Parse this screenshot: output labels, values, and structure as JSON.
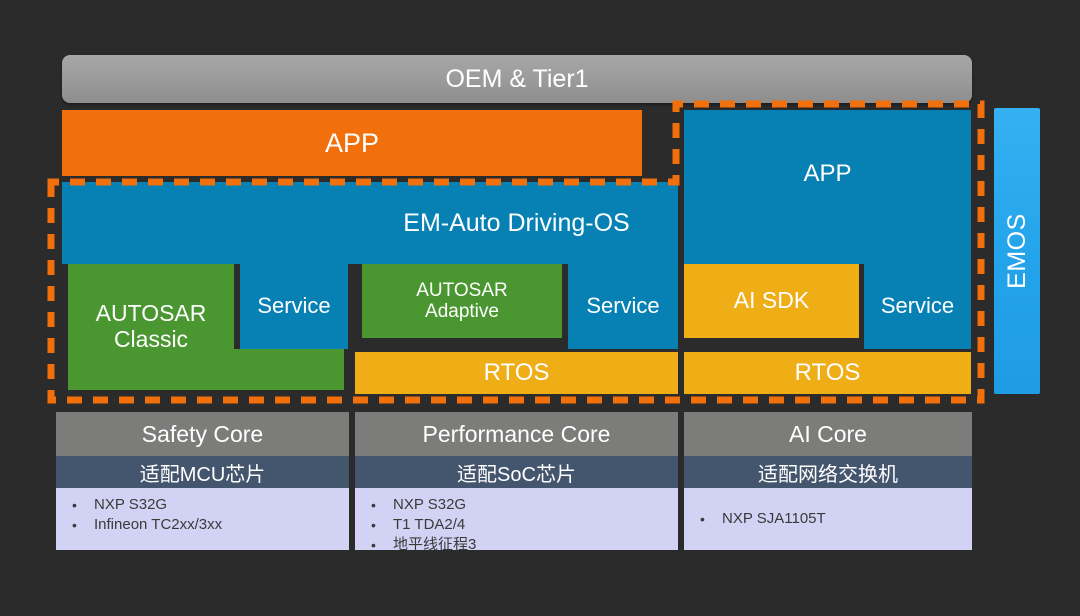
{
  "colors": {
    "background": "#2b2b2b",
    "orange": "#f2700b",
    "blue": "#0781b4",
    "green": "#4a9630",
    "amber": "#efad16",
    "gray_bar": "#9d9d9d",
    "emos_blue": "#23a3ea",
    "core_title_gray": "#7c7c7a",
    "core_sub_navy": "#44556e",
    "core_body_lavender": "#d2d2f5",
    "dashed_highlight": "#f2700b"
  },
  "top": {
    "oem_label": "OEM & Tier1"
  },
  "stack": {
    "app_left_label": "APP",
    "app_right_label": "APP",
    "os_label": "EM-Auto Driving-OS",
    "service_1_label": "Service",
    "service_2_label": "Service",
    "service_3_label": "Service",
    "autosar_classic_line1": "AUTOSAR",
    "autosar_classic_line2": "Classic",
    "autosar_adaptive_line1": "AUTOSAR",
    "autosar_adaptive_line2": "Adaptive",
    "ai_sdk_label": "AI SDK",
    "rtos_1_label": "RTOS",
    "rtos_2_label": "RTOS",
    "emos_label": "EMOS"
  },
  "cores": [
    {
      "title": "Safety Core",
      "subtitle": "适配MCU芯片",
      "items": [
        "NXP S32G",
        "Infineon TC2xx/3xx"
      ]
    },
    {
      "title": "Performance Core",
      "subtitle": "适配SoC芯片",
      "items": [
        "NXP S32G",
        "T1 TDA2/4",
        "地平线征程3"
      ]
    },
    {
      "title": "AI Core",
      "subtitle": "适配网络交换机",
      "items": [
        "NXP SJA1105T"
      ]
    }
  ]
}
